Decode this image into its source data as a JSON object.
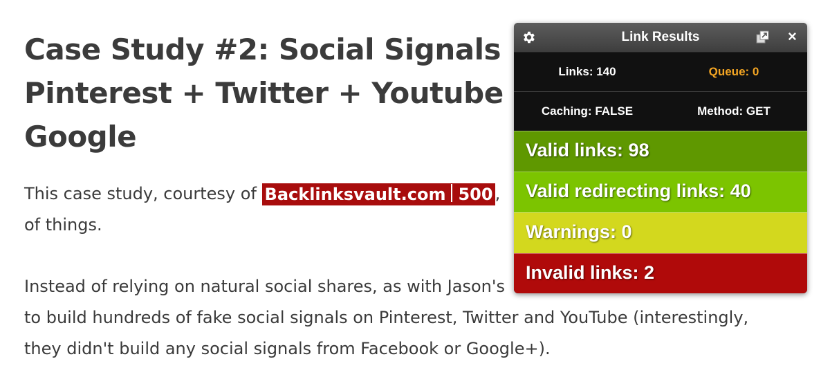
{
  "article": {
    "headline_lines": [
      "Case Study #2: Social Signals",
      "Pinterest + Twitter + Youtube",
      "Google"
    ],
    "para1_before": "This case study, courtesy of ",
    "badge_site": "Backlinksvault.com",
    "badge_count": "500",
    "para1_after": ",",
    "para1_line2": "of things.",
    "para2_lines": [
      "Instead of relying on natural social shares, as with Jason's",
      "to build hundreds of fake social signals on Pinterest, Twitter and YouTube (interestingly,",
      "they didn't build any social signals from Facebook or Google+)."
    ]
  },
  "panel": {
    "title": "Link Results",
    "icons": {
      "settings": "gear-icon",
      "popout": "popout-icon",
      "close": "×"
    },
    "links": "Links: 140",
    "queue": "Queue: 0",
    "caching": "Caching: FALSE",
    "method": "Method: GET",
    "results": {
      "valid": "Valid links: 98",
      "redirecting": "Valid redirecting links: 40",
      "warnings": "Warnings: 0",
      "invalid": "Invalid links: 2"
    }
  },
  "colors": {
    "badge": "#a80d0d",
    "valid": "#5f9800",
    "redirecting": "#7cc400",
    "warnings": "#d3d81e",
    "invalid": "#b00a0a",
    "queue": "#f5a623"
  }
}
